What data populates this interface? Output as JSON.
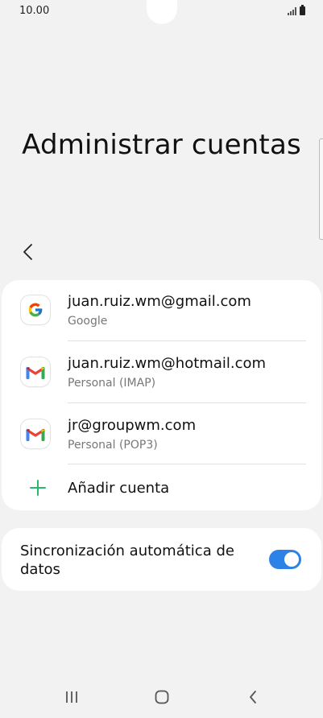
{
  "status_bar": {
    "time": "10.00"
  },
  "header": {
    "title": "Administrar cuentas"
  },
  "accounts": [
    {
      "email": "juan.ruiz.wm@gmail.com",
      "type": "Google",
      "icon": "google-icon"
    },
    {
      "email": "juan.ruiz.wm@hotmail.com",
      "type": "Personal (IMAP)",
      "icon": "gmail-icon"
    },
    {
      "email": "jr@groupwm.com",
      "type": "Personal (POP3)",
      "icon": "gmail-icon"
    }
  ],
  "add_account": {
    "label": "Añadir cuenta",
    "icon": "plus-icon"
  },
  "sync": {
    "label": "Sincronización automática de datos",
    "enabled": true
  },
  "colors": {
    "accent": "#2c82e6",
    "add_icon": "#2bb673",
    "background": "#f2f2f2",
    "card": "#ffffff"
  },
  "nav": {
    "icons": [
      "recent-apps-icon",
      "home-icon",
      "back-icon"
    ]
  }
}
